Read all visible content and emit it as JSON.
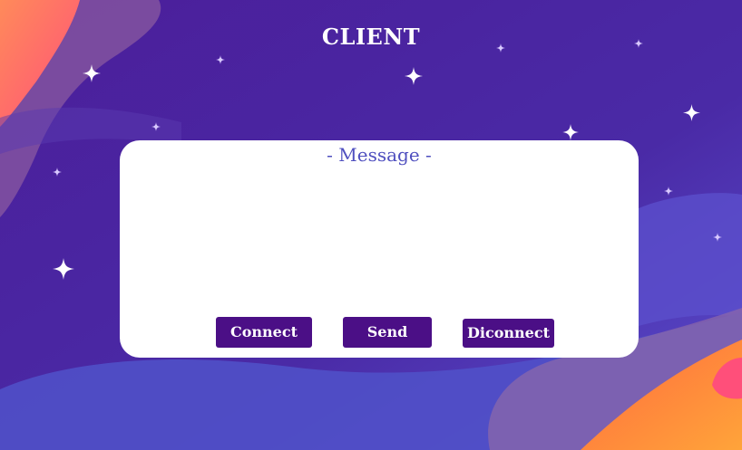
{
  "header": {
    "title": "CLIENT"
  },
  "message_panel": {
    "heading": "- Message -",
    "message_value": ""
  },
  "buttons": {
    "connect_label": "Connect",
    "send_label": "Send",
    "disconnect_label": "Diconnect"
  },
  "colors": {
    "background_purple": "#4a24a0",
    "button_purple": "#4b0f86",
    "heading_blue": "#4f4fbf",
    "accent_orange": "#ff8a3d",
    "accent_pink": "#ff5a7a"
  },
  "icons": [
    "sparkle-star-icon"
  ]
}
